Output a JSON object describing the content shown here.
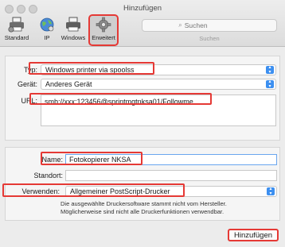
{
  "window": {
    "title": "Hinzufügen"
  },
  "toolbar": {
    "items": [
      {
        "label": "Standard",
        "icon": "printer-default-icon"
      },
      {
        "label": "IP",
        "icon": "globe-icon"
      },
      {
        "label": "Windows",
        "icon": "printer-windows-icon"
      },
      {
        "label": "Erweitert",
        "icon": "gear-icon",
        "selected": true
      }
    ],
    "search": {
      "placeholder": "Suchen",
      "label": "Suchen"
    }
  },
  "connection": {
    "typ_label": "Typ:",
    "typ_value": "Windows printer via spoolss",
    "geraet_label": "Gerät:",
    "geraet_value": "Anderes Gerät",
    "url_label": "URL:",
    "url_value": "smb://xxx:123456@sprintmgtnksa01/Followme"
  },
  "details": {
    "name_label": "Name:",
    "name_value": "Fotokopierer NKSA",
    "standort_label": "Standort:",
    "standort_value": "",
    "verwenden_label": "Verwenden:",
    "verwenden_value": "Allgemeiner PostScript-Drucker",
    "note_line1": "Die ausgewählte Druckersoftware stammt nicht vom Hersteller.",
    "note_line2": "Möglicherweise sind nicht alle Druckerfunktionen verwendbar."
  },
  "footer": {
    "add_label": "Hinzufügen"
  },
  "colors": {
    "highlight": "#e53935",
    "accent": "#3c8ff0"
  }
}
